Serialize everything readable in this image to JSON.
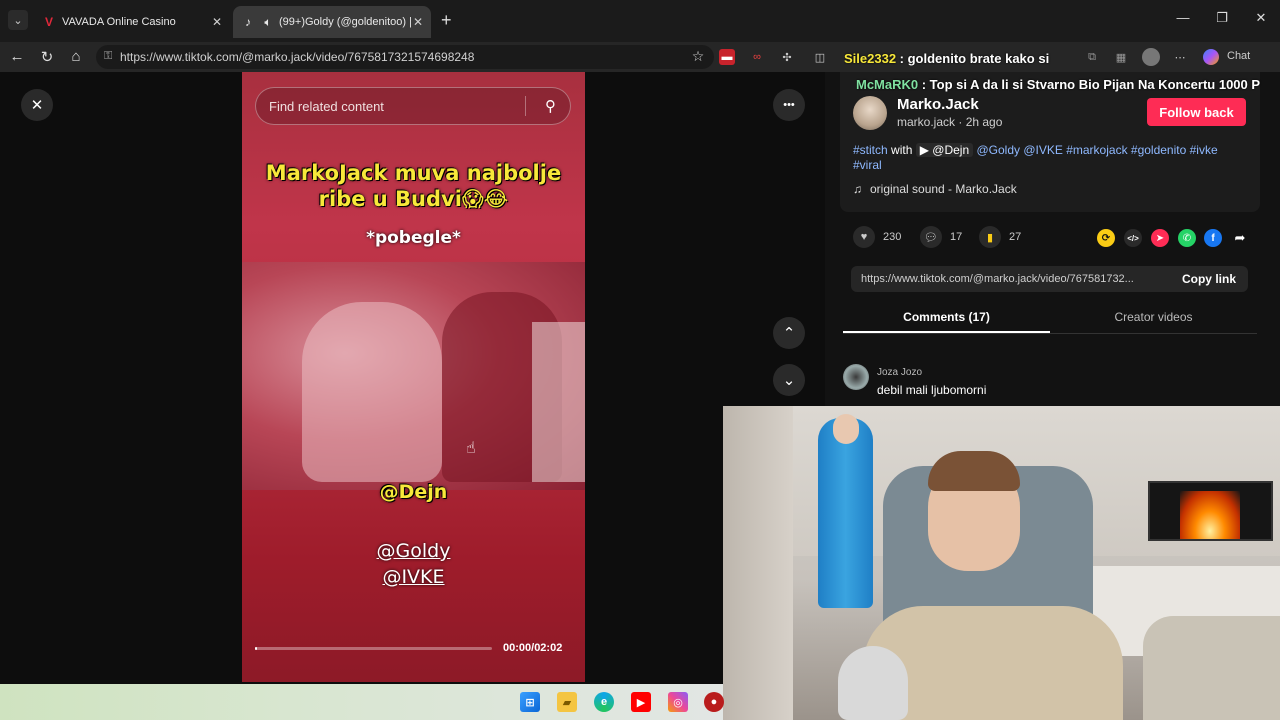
{
  "browser": {
    "tabs": [
      {
        "title": "VAVADA Online Casino",
        "icon": "vavada-logo-icon",
        "active": false
      },
      {
        "title": "(99+)Goldy (@goldenitoo) | T",
        "icon": "tiktok-icon",
        "active": true
      }
    ],
    "new_tab": "+",
    "window_controls": {
      "minimize": "—",
      "maximize": "❐",
      "close": "✕"
    },
    "url": "https://www.tiktok.com/@marko.jack/video/7675817321574698248",
    "chat_label": "Chat"
  },
  "video": {
    "search_placeholder": "Find related content",
    "caption_main": "MarkoJack muva najbolje ribe u Budvi😱😂",
    "caption_sub": "*pobegle*",
    "tag_dejn": "@Dejn",
    "tag_goldy": "@Goldy",
    "tag_ivke": "@IVKE",
    "timecode": "00:00/02:02",
    "progress": 0.01,
    "more_label": "•••",
    "close_label": "✕",
    "up_label": "⌃",
    "down_label": "⌄"
  },
  "chat_overlay": [
    {
      "user": "Sile2332",
      "text": " : goldenito brate kako si",
      "user_color": "#f8e83a"
    },
    {
      "user": "McMaRK0",
      "text": " : Top si A da li si Stvarno Bio Pijan Na Koncertu 1000 P",
      "user_color": "#7fe0a0"
    }
  ],
  "post": {
    "author_name": "Marko.Jack",
    "author_handle": "marko.jack",
    "separator": " · ",
    "time": "2h ago",
    "follow_label": "Follow back",
    "desc_hashtag_stitch": "#stitch",
    "desc_with": " with ",
    "desc_stitch_user": "@Dejn",
    "desc_tags": "@Goldy @IVKE #markojack #goldenito #ivke",
    "desc_tags_2": "#viral",
    "sound": "original sound - Marko.Jack"
  },
  "actions": {
    "likes": "230",
    "comments": "17",
    "saves": "27"
  },
  "share": {
    "link": "https://www.tiktok.com/@marko.jack/video/767581732...",
    "copy_label": "Copy link",
    "embed": "</>"
  },
  "panel_tabs": {
    "comments": "Comments (17)",
    "creator": "Creator videos"
  },
  "comments": [
    {
      "user": "Joza Jozo",
      "text": "debil mali ljubomorni"
    }
  ],
  "colors": {
    "accent": "#fe2c55",
    "hashtag": "#8fb9ff",
    "chat_user_1": "#f8e83a",
    "chat_user_2": "#7fe0a0"
  }
}
